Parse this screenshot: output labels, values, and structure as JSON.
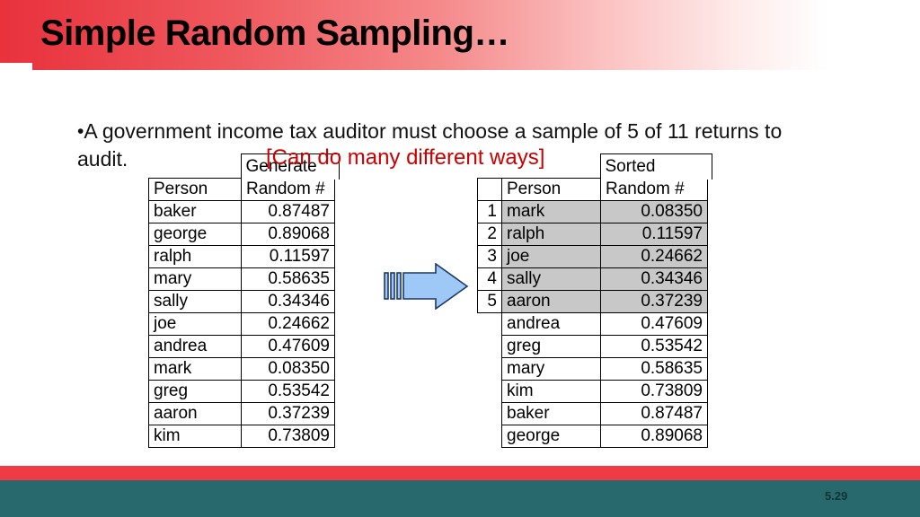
{
  "slide": {
    "title": "Simple Random Sampling…",
    "bullet_marker": "•",
    "bullet_text": "A government income tax auditor must choose a sample of 5 of 11 returns to audit.",
    "note": "[Can do many different ways]",
    "slide_number": "5.29",
    "colors": {
      "title_bar_start": "#e8323c",
      "title_bar_end": "#ffffff",
      "note_red": "#cc0000",
      "footer_stripe": "#ee3b46",
      "footer_band": "#27696d",
      "highlight_row": "#c8c8c8",
      "arrow_fill": "#9ec9f7",
      "arrow_stroke": "#1f3864"
    }
  },
  "unsorted_table": {
    "name": "generated-random-numbers",
    "header_overflow": "Generate",
    "columns": [
      "Person",
      "Random #"
    ],
    "rows": [
      {
        "person": "baker",
        "random": "0.87487"
      },
      {
        "person": "george",
        "random": "0.89068"
      },
      {
        "person": "ralph",
        "random": "0.11597"
      },
      {
        "person": "mary",
        "random": "0.58635"
      },
      {
        "person": "sally",
        "random": "0.34346"
      },
      {
        "person": "joe",
        "random": "0.24662"
      },
      {
        "person": "andrea",
        "random": "0.47609"
      },
      {
        "person": "mark",
        "random": "0.08350"
      },
      {
        "person": "greg",
        "random": "0.53542"
      },
      {
        "person": "aaron",
        "random": "0.37239"
      },
      {
        "person": "kim",
        "random": "0.73809"
      }
    ]
  },
  "sorted_table": {
    "name": "sorted-random-numbers",
    "header_overflow": "Sorted",
    "columns": [
      "",
      "Person",
      "Random #"
    ],
    "rows": [
      {
        "index": "1",
        "person": "mark",
        "random": "0.08350",
        "selected": true
      },
      {
        "index": "2",
        "person": "ralph",
        "random": "0.11597",
        "selected": true
      },
      {
        "index": "3",
        "person": "joe",
        "random": "0.24662",
        "selected": true
      },
      {
        "index": "4",
        "person": "sally",
        "random": "0.34346",
        "selected": true
      },
      {
        "index": "5",
        "person": "aaron",
        "random": "0.37239",
        "selected": true
      },
      {
        "index": "",
        "person": "andrea",
        "random": "0.47609",
        "selected": false
      },
      {
        "index": "",
        "person": "greg",
        "random": "0.53542",
        "selected": false
      },
      {
        "index": "",
        "person": "mary",
        "random": "0.58635",
        "selected": false
      },
      {
        "index": "",
        "person": "kim",
        "random": "0.73809",
        "selected": false
      },
      {
        "index": "",
        "person": "baker",
        "random": "0.87487",
        "selected": false
      },
      {
        "index": "",
        "person": "george",
        "random": "0.89068",
        "selected": false
      }
    ]
  },
  "arrow": {
    "icon": "right-block-arrow-icon"
  }
}
